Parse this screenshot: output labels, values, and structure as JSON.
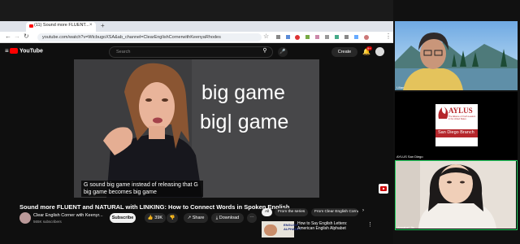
{
  "browser": {
    "tab_title": "(11) Sound more FLUENT...",
    "url": "youtube.com/watch?v=WtcbugoXSA&ab_channel=ClearEnglishCornerwithKeenyaRhodes"
  },
  "youtube": {
    "logo": "YouTube",
    "search_placeholder": "Search",
    "create_label": "Create",
    "notif_count": "9+"
  },
  "video": {
    "line1": "big game",
    "line2": "big| game",
    "caption": "G sound big game instead of releasing that G big game becomes big game",
    "title": "Sound more FLUENT and NATURAL with LINKING: How to Connect Words in Spoken English",
    "channel": "Clear English Corner with Keenyr...",
    "subscribers": "565K subscribers",
    "subscribe_label": "Subscribe",
    "likes": "39K",
    "share_label": "Share",
    "download_label": "Download"
  },
  "sidebar": {
    "chips": [
      "All",
      "From the series",
      "From Clear English Corne"
    ],
    "rec_title": "How to Say English Letters: American English Alphabet",
    "rec_thumb_text": "ENGLISH ALPHABET"
  },
  "zoom": {
    "participant1": "Lilian",
    "org_name": "AYLUS",
    "org_sub": "The Alliance of Youth Leaders in the United States",
    "org_branch": "San Diego Branch",
    "participant2": "AYLUS San Diego",
    "participant3": "Annabel Jin"
  }
}
